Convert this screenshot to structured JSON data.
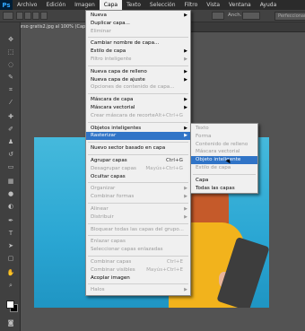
{
  "menubar": {
    "logo": "Ps",
    "items": [
      "Archivo",
      "Edición",
      "Imagen",
      "Capa",
      "Texto",
      "Selección",
      "Filtro",
      "Vista",
      "Ventana",
      "Ayuda"
    ],
    "active": "Capa"
  },
  "options": {
    "anch_label": "Anch.:",
    "refine_label": "Perfeccionar"
  },
  "document": {
    "tab_title": "curso gratis2.jpg al 100% (Capa 0, RGB..."
  },
  "layer_menu": {
    "items": [
      {
        "label": "Nueva",
        "arrow": true
      },
      {
        "label": "Duplicar capa..."
      },
      {
        "label": "Eliminar",
        "disabled": true
      },
      {
        "sep": true
      },
      {
        "label": "Cambiar nombre de capa..."
      },
      {
        "label": "Estilo de capa",
        "arrow": true
      },
      {
        "label": "Filtro inteligente",
        "disabled": true,
        "arrow": true
      },
      {
        "sep": true
      },
      {
        "label": "Nueva capa de relleno",
        "arrow": true
      },
      {
        "label": "Nueva capa de ajuste",
        "arrow": true
      },
      {
        "label": "Opciones de contenido de capa...",
        "disabled": true
      },
      {
        "sep": true
      },
      {
        "label": "Máscara de capa",
        "arrow": true
      },
      {
        "label": "Máscara vectorial",
        "arrow": true
      },
      {
        "label": "Crear máscara de recorte",
        "shortcut": "Alt+Ctrl+G",
        "disabled": true
      },
      {
        "sep": true
      },
      {
        "label": "Objetos inteligentes",
        "arrow": true
      },
      {
        "label": "Rasterizar",
        "arrow": true,
        "highlighted": true
      },
      {
        "sep": true
      },
      {
        "label": "Nuevo sector basado en capa"
      },
      {
        "sep": true
      },
      {
        "label": "Agrupar capas",
        "shortcut": "Ctrl+G"
      },
      {
        "label": "Desagrupar capas",
        "shortcut": "Mayús+Ctrl+G",
        "disabled": true
      },
      {
        "label": "Ocultar capas"
      },
      {
        "sep": true
      },
      {
        "label": "Organizar",
        "arrow": true,
        "disabled": true
      },
      {
        "label": "Combinar formas",
        "arrow": true,
        "disabled": true
      },
      {
        "sep": true
      },
      {
        "label": "Alinear",
        "arrow": true,
        "disabled": true
      },
      {
        "label": "Distribuir",
        "arrow": true,
        "disabled": true
      },
      {
        "sep": true
      },
      {
        "label": "Bloquear todas las capas del grupo...",
        "disabled": true
      },
      {
        "sep": true
      },
      {
        "label": "Enlazar capas",
        "disabled": true
      },
      {
        "label": "Seleccionar capas enlazadas",
        "disabled": true
      },
      {
        "sep": true
      },
      {
        "label": "Combinar capas",
        "shortcut": "Ctrl+E",
        "disabled": true
      },
      {
        "label": "Combinar visibles",
        "shortcut": "Mayús+Ctrl+E",
        "disabled": true
      },
      {
        "label": "Acoplar imagen"
      },
      {
        "sep": true
      },
      {
        "label": "Halos",
        "arrow": true,
        "disabled": true
      }
    ]
  },
  "rasterize_menu": {
    "items": [
      {
        "label": "Texto",
        "disabled": true
      },
      {
        "label": "Forma",
        "disabled": true
      },
      {
        "label": "Contenido de relleno",
        "disabled": true
      },
      {
        "label": "Máscara vectorial",
        "disabled": true
      },
      {
        "label": "Objeto inteligente",
        "highlighted": true
      },
      {
        "label": "Estilo de capa",
        "disabled": true
      },
      {
        "sep": true
      },
      {
        "label": "Capa"
      },
      {
        "label": "Todas las capas"
      }
    ]
  },
  "colors": {
    "menu_highlight": "#3074c7",
    "menubar_bg": "#2b2b2b",
    "canvas_bg": "#2aa6d3"
  },
  "icons": [
    "move-icon",
    "marquee-icon",
    "lasso-icon",
    "quick-select-icon",
    "crop-icon",
    "eyedropper-icon",
    "healing-icon",
    "brush-icon",
    "stamp-icon",
    "history-brush-icon",
    "eraser-icon",
    "gradient-icon",
    "blur-icon",
    "dodge-icon",
    "pen-icon",
    "type-icon",
    "path-select-icon",
    "shape-icon",
    "hand-icon",
    "zoom-icon"
  ]
}
